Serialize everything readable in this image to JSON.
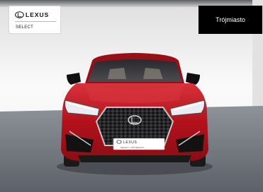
{
  "brand": {
    "name": "LEXUS",
    "program": "SELECT"
  },
  "location": {
    "label": "Trójmiasto"
  },
  "vehicle": {
    "color": "#c51b24"
  },
  "colors": {
    "floor": "#6f757c",
    "wall": "#f4f4f4",
    "badge_bg": "#000000"
  },
  "plate": {
    "brand": "LEXUS",
    "sub": "SELECT | TRÓJMIASTO"
  }
}
